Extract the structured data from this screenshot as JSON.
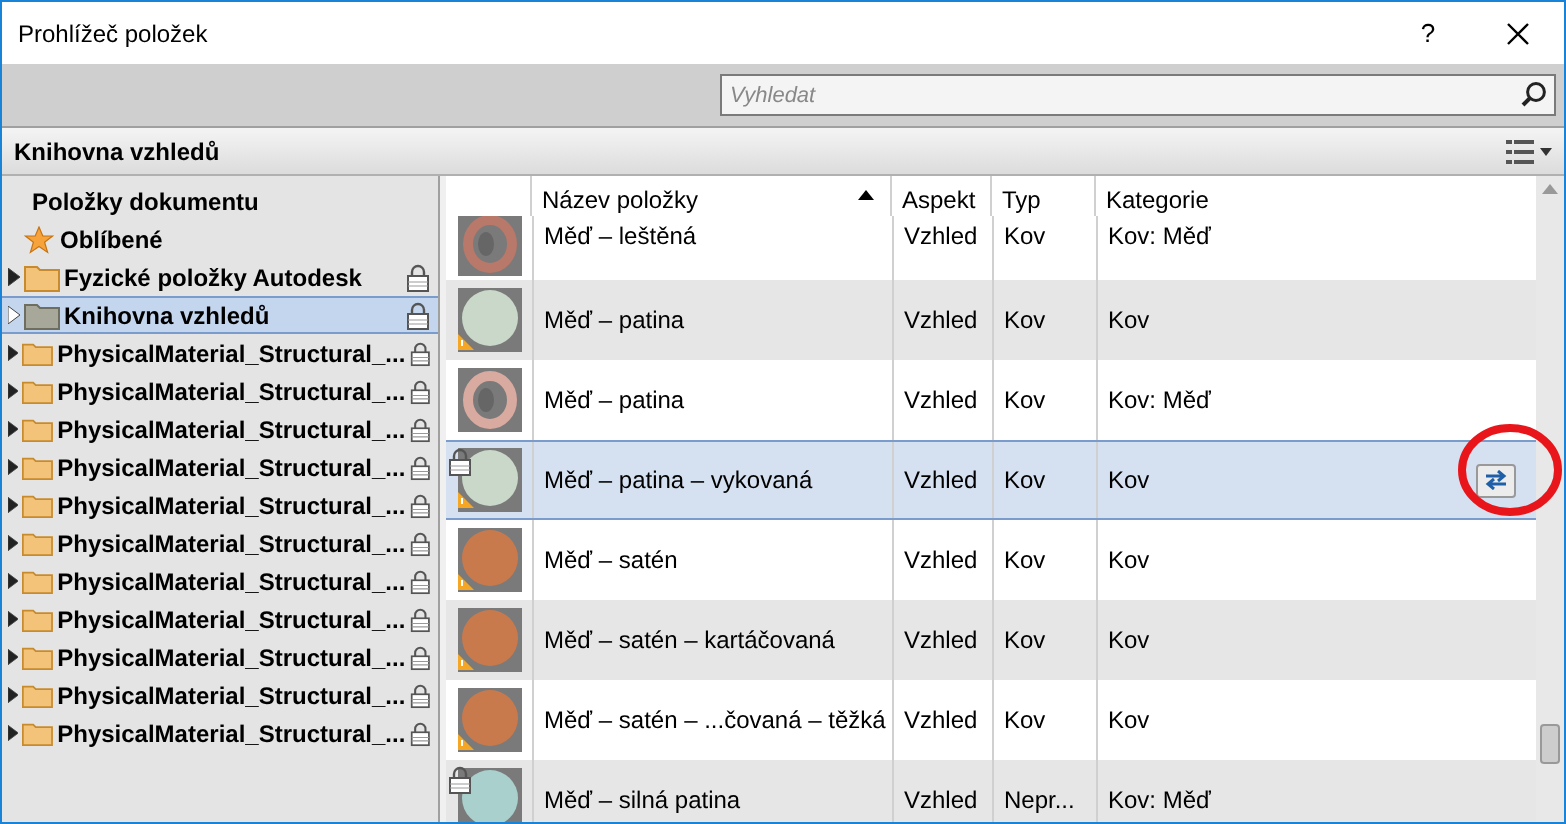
{
  "window": {
    "title": "Prohlížeč položek",
    "help": "?"
  },
  "search": {
    "placeholder": "Vyhledat"
  },
  "section": {
    "title": "Knihovna vzhledů"
  },
  "sidebar": {
    "items": [
      {
        "kind": "heading",
        "label": "Položky dokumentu"
      },
      {
        "kind": "favorites",
        "label": "Oblíbené"
      },
      {
        "kind": "folder",
        "label": "Fyzické položky Autodesk",
        "locked": true,
        "selected": false
      },
      {
        "kind": "folder",
        "label": "Knihovna vzhledů",
        "locked": true,
        "selected": true
      },
      {
        "kind": "folder",
        "label": "PhysicalMaterial_Structural_...",
        "locked": true,
        "selected": false
      },
      {
        "kind": "folder",
        "label": "PhysicalMaterial_Structural_...",
        "locked": true,
        "selected": false
      },
      {
        "kind": "folder",
        "label": "PhysicalMaterial_Structural_...",
        "locked": true,
        "selected": false
      },
      {
        "kind": "folder",
        "label": "PhysicalMaterial_Structural_...",
        "locked": true,
        "selected": false
      },
      {
        "kind": "folder",
        "label": "PhysicalMaterial_Structural_...",
        "locked": true,
        "selected": false
      },
      {
        "kind": "folder",
        "label": "PhysicalMaterial_Structural_...",
        "locked": true,
        "selected": false
      },
      {
        "kind": "folder",
        "label": "PhysicalMaterial_Structural_...",
        "locked": true,
        "selected": false
      },
      {
        "kind": "folder",
        "label": "PhysicalMaterial_Structural_...",
        "locked": true,
        "selected": false
      },
      {
        "kind": "folder",
        "label": "PhysicalMaterial_Structural_...",
        "locked": true,
        "selected": false
      },
      {
        "kind": "folder",
        "label": "PhysicalMaterial_Structural_...",
        "locked": true,
        "selected": false
      },
      {
        "kind": "folder",
        "label": "PhysicalMaterial_Structural_...",
        "locked": true,
        "selected": false
      }
    ]
  },
  "table": {
    "columns": [
      "Název položky",
      "Aspekt",
      "Typ",
      "Kategorie"
    ],
    "rows": [
      {
        "kind": "torus",
        "color": "#b8786a",
        "warning": false,
        "locked": false,
        "selected": false,
        "name": "Měď – leštěná",
        "aspect": "Vzhled",
        "type": "Kov",
        "category": "Kov: Měď"
      },
      {
        "kind": "sphere",
        "color": "#c9d8c8",
        "warning": true,
        "locked": false,
        "selected": false,
        "name": "Měď – patina",
        "aspect": "Vzhled",
        "type": "Kov",
        "category": "Kov"
      },
      {
        "kind": "torus",
        "color": "#d9aaa0",
        "warning": false,
        "locked": false,
        "selected": false,
        "name": "Měď – patina",
        "aspect": "Vzhled",
        "type": "Kov",
        "category": "Kov: Měď"
      },
      {
        "kind": "sphere",
        "color": "#c9d8c8",
        "warning": true,
        "locked": true,
        "selected": true,
        "annotated": true,
        "name": "Měď – patina – vykovaná",
        "aspect": "Vzhled",
        "type": "Kov",
        "category": "Kov"
      },
      {
        "kind": "sphere",
        "color": "#c97a4c",
        "warning": true,
        "locked": false,
        "selected": false,
        "name": "Měď – satén",
        "aspect": "Vzhled",
        "type": "Kov",
        "category": "Kov"
      },
      {
        "kind": "sphere",
        "color": "#c97a4c",
        "warning": true,
        "locked": false,
        "selected": false,
        "name": "Měď – satén – kartáčovaná",
        "aspect": "Vzhled",
        "type": "Kov",
        "category": "Kov"
      },
      {
        "kind": "sphere",
        "color": "#c97a4c",
        "warning": true,
        "locked": false,
        "selected": false,
        "name": "Měď – satén – ...čovaná – těžká",
        "aspect": "Vzhled",
        "type": "Kov",
        "category": "Kov"
      },
      {
        "kind": "sphere",
        "color": "#a9d0cc",
        "warning": false,
        "locked": true,
        "selected": false,
        "name": "Měď – silná patina",
        "aspect": "Vzhled",
        "type": "Nepr...",
        "category": "Kov: Měď"
      }
    ]
  }
}
